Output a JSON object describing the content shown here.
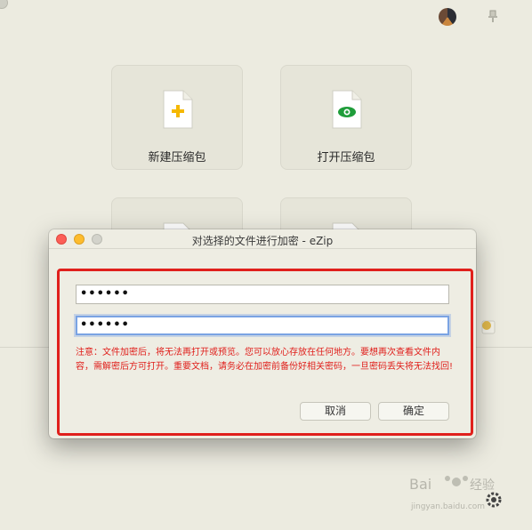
{
  "main": {
    "tiles": [
      {
        "label": "新建压缩包",
        "icon": "new-archive-icon",
        "accent": "#f5b800"
      },
      {
        "label": "打开压缩包",
        "icon": "open-archive-icon",
        "accent": "#1f9d3a"
      }
    ]
  },
  "dialog": {
    "title": "对选择的文件进行加密 - eZip",
    "password": "••••••",
    "confirm_password": "••••••",
    "notice": "注意：文件加密后，将无法再打开或预览。您可以放心存放在任何地方。要想再次查看文件内容，需解密后方可打开。重要文档，请务必在加密前备份好相关密码，一旦密码丢失将无法找回!",
    "cancel_label": "取消",
    "ok_label": "确定"
  },
  "colors": {
    "highlight": "#e0201c",
    "notice_text": "#e0201c",
    "background": "#ecebe0"
  }
}
